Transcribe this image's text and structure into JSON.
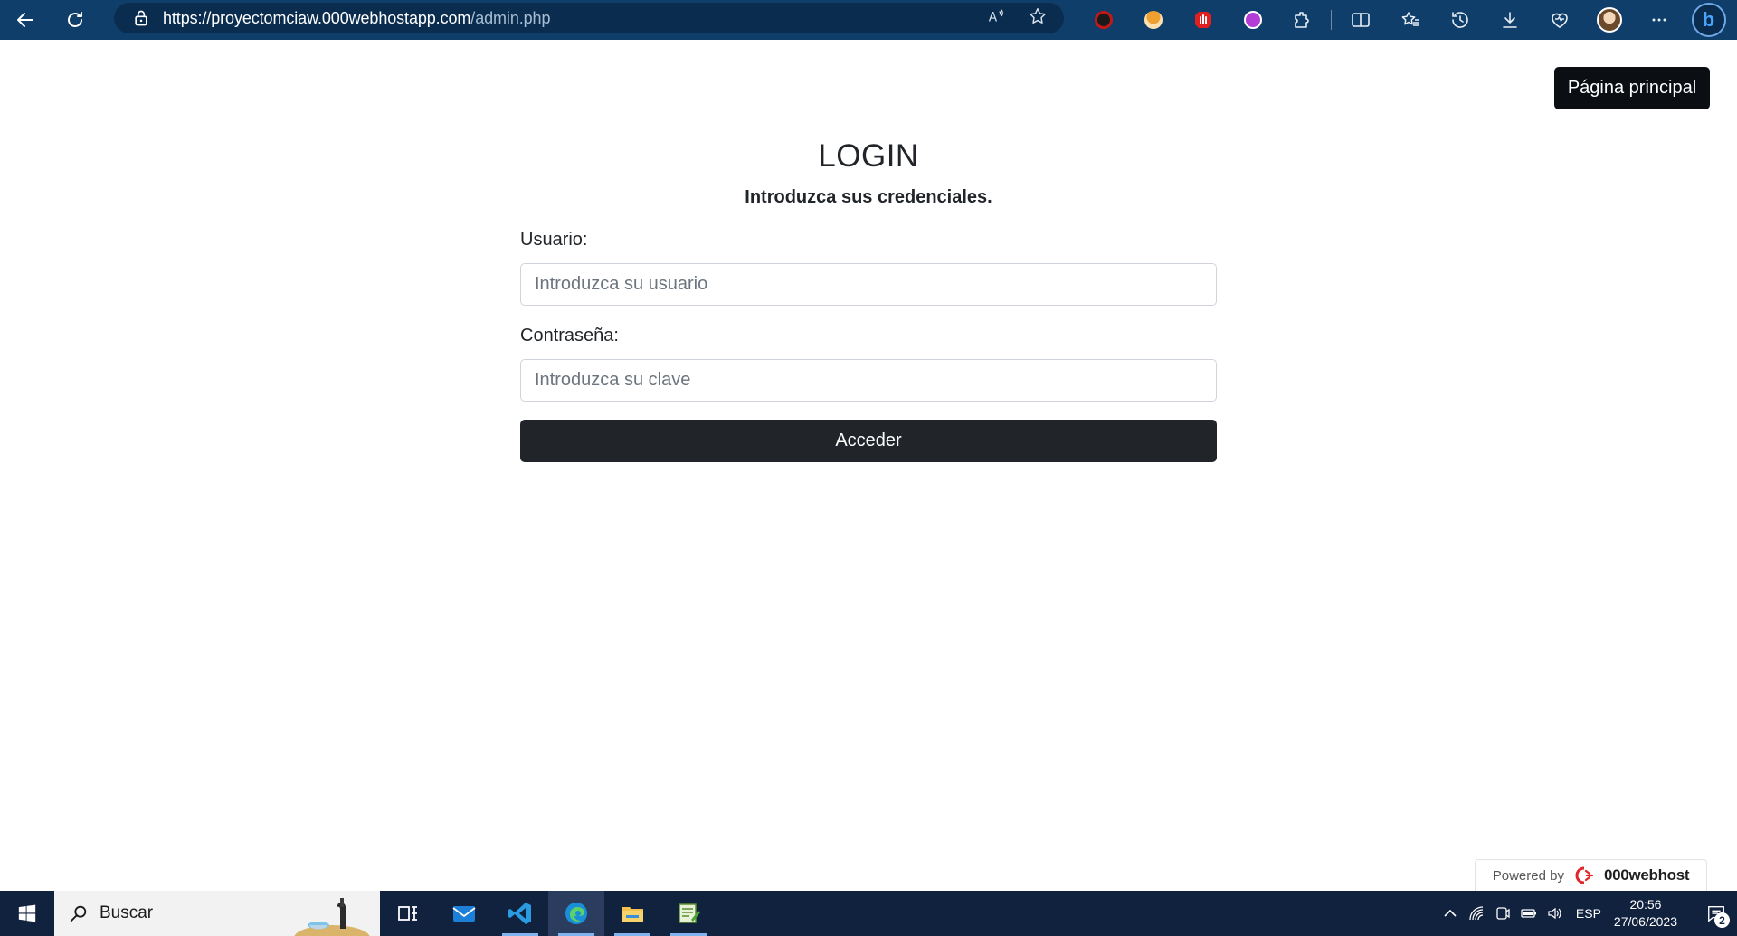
{
  "browser": {
    "url_host": "https://proyectomciaw.000webhostapp.com",
    "url_path": "/admin.php"
  },
  "page": {
    "home_button": "Página principal",
    "title": "LOGIN",
    "subtitle": "Introduzca sus credenciales.",
    "username_label": "Usuario:",
    "username_placeholder": "Introduzca su usuario",
    "username_value": "",
    "password_label": "Contraseña:",
    "password_placeholder": "Introduzca su clave",
    "password_value": "",
    "submit_label": "Acceder"
  },
  "footer_badge": {
    "powered_by": "Powered by",
    "brand": "000webhost"
  },
  "taskbar": {
    "search_label": "Buscar",
    "language": "ESP",
    "time": "20:56",
    "date": "27/06/2023",
    "notification_count": "2"
  },
  "colors": {
    "browser_bar": "#0f3e6b",
    "taskbar": "#11223f",
    "button_dark": "#212529",
    "home_button": "#0b0f14"
  }
}
